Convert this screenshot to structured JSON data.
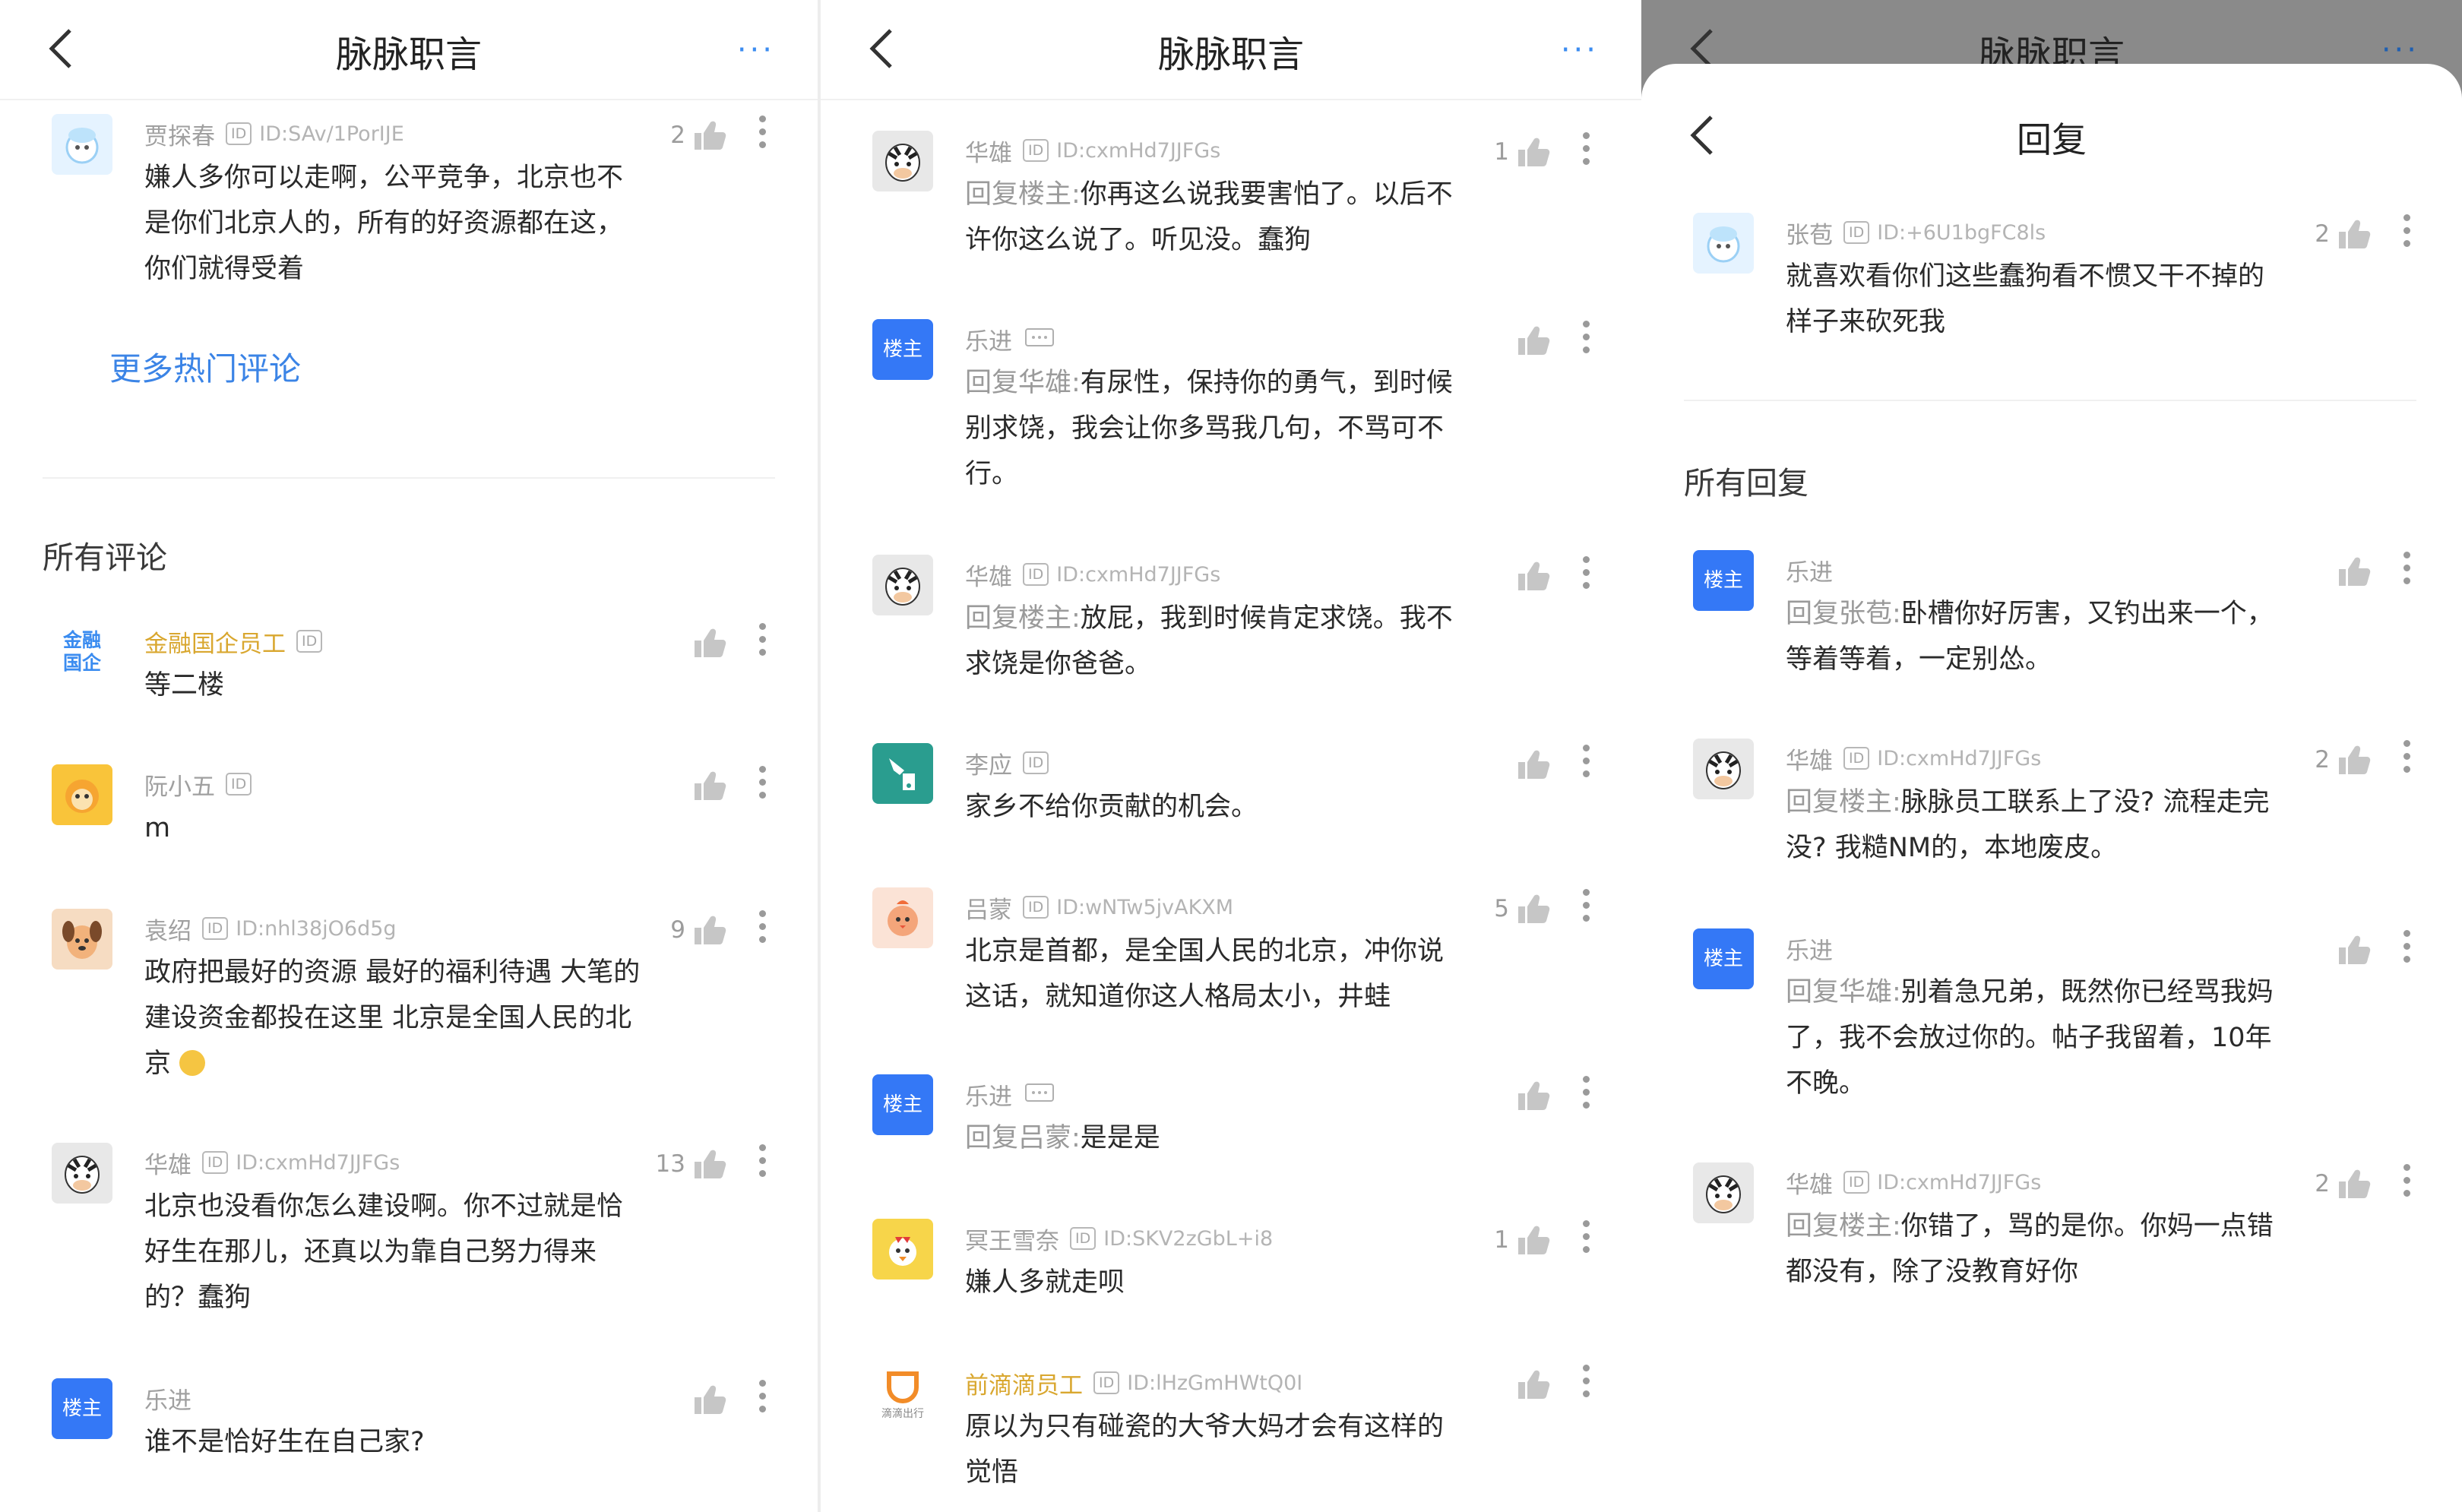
{
  "panels": [
    {
      "title": "脉脉职言",
      "more_label": "···",
      "more_hot": "更多热门评论",
      "section": "所有评论",
      "comments": [
        {
          "name": "贾探春",
          "uid": "ID:SAv/1PorIJE",
          "likes": "2",
          "text": "嫌人多你可以走啊，公平竞争，北京也不是你们北京人的，所有的好资源都在这，你们就得受着"
        },
        {
          "name": "金融国企员工",
          "likes": "",
          "text": "等二楼"
        },
        {
          "name": "阮小五",
          "likes": "",
          "text": "m"
        },
        {
          "name": "袁绍",
          "uid": "ID:nhl38jO6d5g",
          "likes": "9",
          "text": "政府把最好的资源 最好的福利待遇 大笔的建设资金都投在这里 北京是全国人民的北京"
        },
        {
          "name": "华雄",
          "uid": "ID:cxmHd7JJFGs",
          "likes": "13",
          "text": "北京也没看你怎么建设啊。你不过就是恰好生在那儿，还真以为靠自己努力得来的？蠢狗"
        },
        {
          "name": "乐进",
          "likes": "",
          "text": "谁不是恰好生在自己家?"
        }
      ]
    },
    {
      "title": "脉脉职言",
      "more_label": "···",
      "comments": [
        {
          "name": "华雄",
          "uid": "ID:cxmHd7JJFGs",
          "likes": "1",
          "reply_to": "回复楼主:",
          "text": "你再这么说我要害怕了。以后不许你这么说了。听见没。蠢狗"
        },
        {
          "name": "乐进",
          "likes": "",
          "reply_to": "回复华雄:",
          "text": "有尿性，保持你的勇气，到时候别求饶，我会让你多骂我几句，不骂可不行。"
        },
        {
          "name": "华雄",
          "uid": "ID:cxmHd7JJFGs",
          "likes": "",
          "reply_to": "回复楼主:",
          "text": "放屁，我到时候肯定求饶。我不求饶是你爸爸。"
        },
        {
          "name": "李应",
          "likes": "",
          "text": "家乡不给你贡献的机会。"
        },
        {
          "name": "吕蒙",
          "uid": "ID:wNTw5jvAKXM",
          "likes": "5",
          "text": "北京是首都，是全国人民的北京，冲你说这话，就知道你这人格局太小，井蛙"
        },
        {
          "name": "乐进",
          "likes": "",
          "reply_to": "回复吕蒙:",
          "text": "是是是"
        },
        {
          "name": "冥王雪奈",
          "uid": "ID:SKV2zGbL+i8",
          "likes": "1",
          "text": "嫌人多就走呗"
        },
        {
          "name": "前滴滴员工",
          "uid": "ID:lHzGmHWtQ0I",
          "likes": "",
          "text": "原以为只有碰瓷的大爷大妈才会有这样的觉悟"
        }
      ]
    },
    {
      "title": "脉脉职言",
      "more_label": "···",
      "sheet_title": "回复",
      "section": "所有回复",
      "comments": [
        {
          "name": "张苞",
          "uid": "ID:+6U1bgFC8ls",
          "likes": "2",
          "text": "就喜欢看你们这些蠢狗看不惯又干不掉的样子来砍死我"
        },
        {
          "name": "乐进",
          "likes": "",
          "reply_to": "回复张苞:",
          "text": "卧槽你好厉害，又钓出来一个，等着等着，一定别怂。"
        },
        {
          "name": "华雄",
          "uid": "ID:cxmHd7JJFGs",
          "likes": "2",
          "reply_to": "回复楼主:",
          "text": "脉脉员工联系上了没? 流程走完没? 我糙NM的，本地废皮。"
        },
        {
          "name": "乐进",
          "likes": "",
          "reply_to": "回复华雄:",
          "text": "别着急兄弟，既然你已经骂我妈了，我不会放过你的。帖子我留着，10年不晚。"
        },
        {
          "name": "华雄",
          "uid": "ID:cxmHd7JJFGs",
          "likes": "2",
          "reply_to": "回复楼主:",
          "text": "你错了，骂的是你。你妈一点错都没有，除了没教育好你"
        }
      ]
    }
  ],
  "badges": {
    "id_tag": "ID",
    "host_badge": "楼主",
    "finance_badge_1": "金融",
    "finance_badge_2": "国企",
    "didi_label": "滴滴出行"
  },
  "colors": {
    "accent": "#3b84e6",
    "host_badge_bg": "#3478f6",
    "gold_name": "#d9a72f",
    "dim_overlay": "#8a8a8a"
  }
}
